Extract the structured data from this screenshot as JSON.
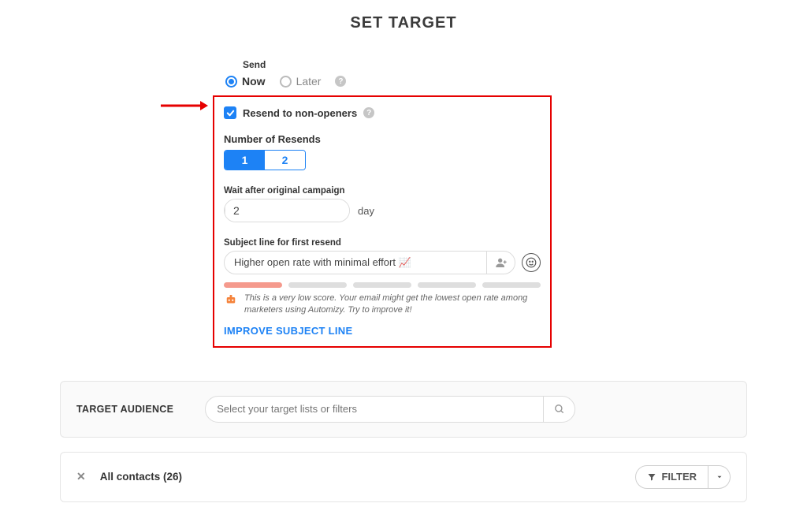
{
  "page": {
    "title": "SET TARGET"
  },
  "send": {
    "label": "Send",
    "now_label": "Now",
    "later_label": "Later"
  },
  "resend": {
    "checkbox_label": "Resend to non-openers",
    "number_label": "Number of Resends",
    "option1": "1",
    "option2": "2",
    "wait_label": "Wait after original campaign",
    "wait_value": "2",
    "wait_unit": "day",
    "subject_label": "Subject line for first resend",
    "subject_value": "Higher open rate with minimal effort 📈",
    "score_tip": "This is a very low score. Your email might get the lowest open rate among marketers using Automizy. Try to improve it!",
    "improve_label": "IMPROVE SUBJECT LINE"
  },
  "audience": {
    "label": "TARGET AUDIENCE",
    "placeholder": "Select your target lists or filters"
  },
  "contacts": {
    "label": "All contacts (26)",
    "filter_label": "FILTER"
  }
}
